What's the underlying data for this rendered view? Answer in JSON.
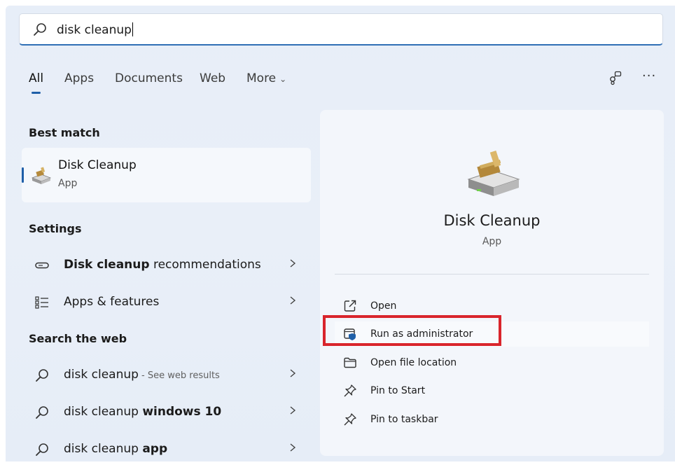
{
  "search": {
    "value": "disk cleanup",
    "icon": "search-icon"
  },
  "tabs": [
    {
      "label": "All",
      "active": true
    },
    {
      "label": "Apps"
    },
    {
      "label": "Documents"
    },
    {
      "label": "Web"
    },
    {
      "label": "More",
      "icon": "chevron-down-icon"
    }
  ],
  "toolbar": {
    "share_icon": "share-icon",
    "more_icon": "ellipsis-icon",
    "more_glyph": "···"
  },
  "best_match": {
    "heading": "Best match",
    "title": "Disk Cleanup",
    "subtitle": "App",
    "icon": "disk-cleanup-icon"
  },
  "settings": {
    "heading": "Settings",
    "items": [
      {
        "bold": "Disk cleanup",
        "rest": " recommendations",
        "icon": "storage-icon"
      },
      {
        "bold": "",
        "rest": "Apps & features",
        "icon": "apps-list-icon"
      }
    ]
  },
  "web": {
    "heading": "Search the web",
    "items": [
      {
        "normal": "disk cleanup",
        "bold": "",
        "hint": " - See web results",
        "icon": "search-icon"
      },
      {
        "normal": "disk cleanup ",
        "bold": "windows 10",
        "hint": "",
        "icon": "search-icon"
      },
      {
        "normal": "disk cleanup ",
        "bold": "app",
        "hint": "",
        "icon": "search-icon"
      }
    ]
  },
  "preview": {
    "title": "Disk Cleanup",
    "subtitle": "App",
    "actions": [
      {
        "label": "Open",
        "icon": "open-icon"
      },
      {
        "label": "Run as administrator",
        "icon": "shield-window-icon"
      },
      {
        "label": "Open file location",
        "icon": "folder-icon"
      },
      {
        "label": "Pin to Start",
        "icon": "pin-icon"
      },
      {
        "label": "Pin to taskbar",
        "icon": "pin-icon"
      }
    ]
  },
  "colors": {
    "accent": "#1f5fa8",
    "highlight_box": "#d9252c",
    "panel_bg": "#e7eef8"
  }
}
